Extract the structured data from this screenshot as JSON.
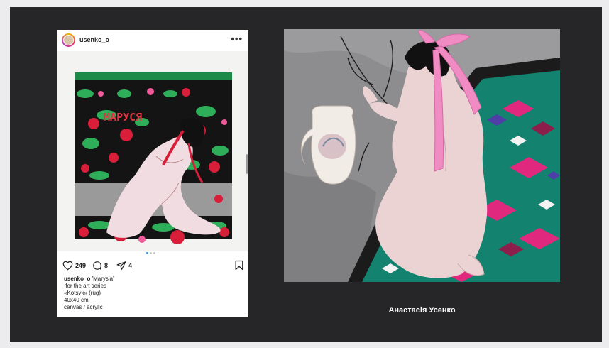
{
  "post": {
    "username": "usenko_o",
    "more_icon": "•••",
    "likes": "249",
    "comments": "8",
    "shares": "4",
    "carousel": {
      "count": 3,
      "active": 1
    },
    "caption": {
      "user": "usenko_o",
      "first_line_rest": " 'Marysia'",
      "lines": [
        " for the art series",
        "«Kotsyk» (rug)",
        "40x40 cm",
        "canvas / acrylic"
      ]
    },
    "artwork_text": "МАРУСЯ"
  },
  "painting": {
    "artist_name": "Анастасія Усенко"
  },
  "colors": {
    "stage": "#262628",
    "background": "#ececee",
    "accent_blue": "#3897f0",
    "rug_red": "#d91e3a",
    "rug_green": "#2fae5a",
    "ribbon_pink": "#f08bc3"
  },
  "icons": [
    "more-icon",
    "heart-icon",
    "comment-icon",
    "share-icon",
    "bookmark-icon"
  ]
}
